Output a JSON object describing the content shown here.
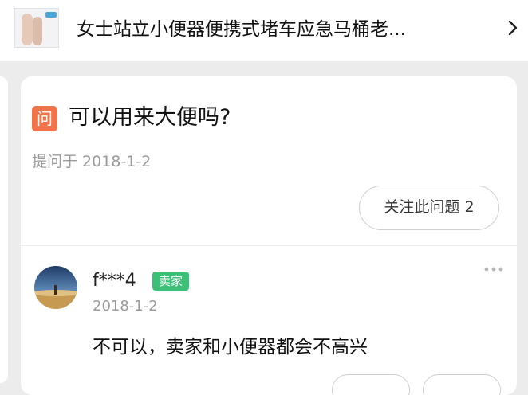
{
  "product": {
    "title": "女士站立小便器便携式堵车应急马桶老...",
    "thumbnail_icon": "product-thumbnail",
    "chevron_icon": "chevron-right-icon"
  },
  "question": {
    "badge": "问",
    "title": "可以用来大便吗?",
    "asked_date": "提问于 2018-1-2",
    "follow_label": "关注此问题 2"
  },
  "answer": {
    "name": "f***4",
    "badge": "卖家",
    "date": "2018-1-2",
    "text": "不可以，卖家和小便器都会不高兴",
    "more_icon": "more-icon"
  },
  "colors": {
    "question_badge": "#f0734a",
    "seller_badge": "#3cbf77",
    "page_background": "#ececec"
  }
}
